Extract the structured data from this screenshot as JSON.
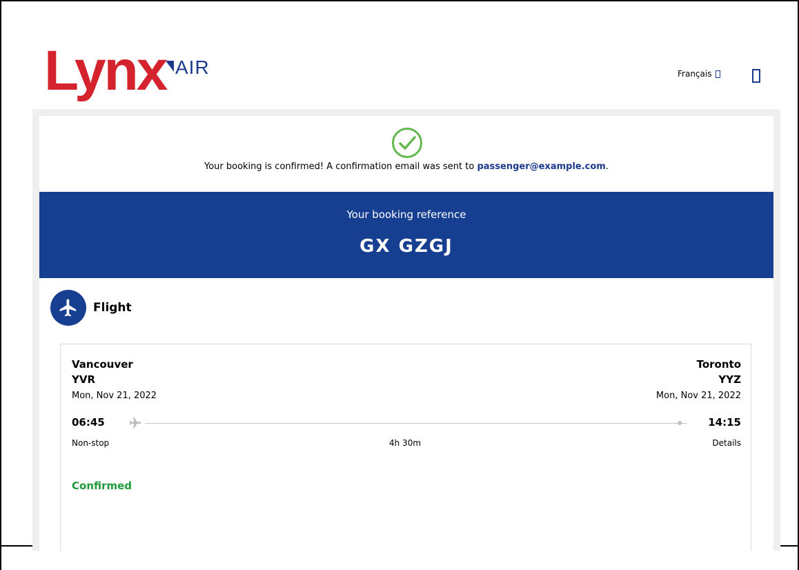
{
  "header": {
    "logo_text": "Lynx",
    "logo_suffix": "AIR",
    "language_label": "Français"
  },
  "confirmation": {
    "message_prefix": "Your booking is confirmed! A confirmation email was sent to",
    "email": "passenger@example.com",
    "message_suffix": "."
  },
  "booking": {
    "label": "Your booking reference",
    "code": "GX GZGJ"
  },
  "flight": {
    "section_title": "Flight",
    "departure": {
      "city": "Vancouver",
      "code": "YVR",
      "date": "Mon, Nov 21, 2022",
      "time": "06:45"
    },
    "arrival": {
      "city": "Toronto",
      "code": "YYZ",
      "date": "Mon, Nov 21, 2022",
      "time": "14:15"
    },
    "stops": "Non-stop",
    "duration": "4h 30m",
    "details_link": "Details",
    "status": "Confirmed"
  },
  "colors": {
    "brand_red": "#d4232c",
    "brand_blue": "#163f92",
    "success_green": "#1f9a3a"
  }
}
